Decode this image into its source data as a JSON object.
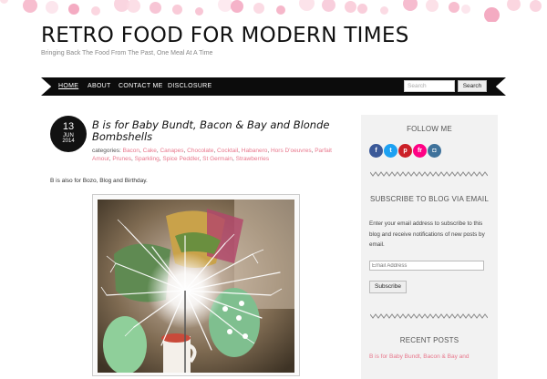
{
  "site": {
    "title": "RETRO FOOD FOR MODERN TIMES",
    "tagline": "Bringing Back The Food From The Past, One Meal At A Time"
  },
  "nav": {
    "items": [
      "HOME",
      "ABOUT",
      "CONTACT ME",
      "DISCLOSURE"
    ],
    "search_placeholder": "Search",
    "search_button": "Search"
  },
  "post": {
    "date": {
      "day": "13",
      "month": "JUN",
      "year": "2014"
    },
    "title": "B is for Baby Bundt, Bacon & Bay and Blonde Bombshells",
    "categories_label": "categories:",
    "categories": [
      "Bacon",
      "Cake",
      "Canapes",
      "Chocolate",
      "Cocktail",
      "Habanero",
      "Hors D'oeuvres",
      "Parfait Amour",
      "Prunes",
      "Sparkling",
      "Spice Peddler",
      "St Germain",
      "Strawberries"
    ],
    "intro": "B is also for Bozo, Blog and Birthday."
  },
  "sidebar": {
    "follow_heading": "FOLLOW ME",
    "social": [
      {
        "icon": "facebook-icon",
        "glyph": "f",
        "color": "#3b5998"
      },
      {
        "icon": "twitter-icon",
        "glyph": "t",
        "color": "#1da1f2"
      },
      {
        "icon": "pinterest-icon",
        "glyph": "p",
        "color": "#cb2027"
      },
      {
        "icon": "flickr-icon",
        "glyph": "fr",
        "color": "#ff0084"
      },
      {
        "icon": "instagram-icon",
        "glyph": "◘",
        "color": "#3f729b"
      }
    ],
    "subscribe_heading": "SUBSCRIBE TO BLOG VIA EMAIL",
    "subscribe_text": "Enter your email address to subscribe to this blog and receive notifications of new posts by email.",
    "email_placeholder": "Email Address",
    "subscribe_button": "Subscribe",
    "recent_heading": "RECENT POSTS",
    "recent_posts": [
      "B is for Baby Bundt, Bacon & Bay and"
    ]
  },
  "theme": {
    "accent": "#e8768b",
    "nav_bg": "#0c0c0c",
    "sidebar_bg": "#f2f2f2",
    "dot_colors": [
      "#f9c8d6",
      "#f6b3c7",
      "#fbd9e3",
      "#f3a6bf"
    ]
  }
}
